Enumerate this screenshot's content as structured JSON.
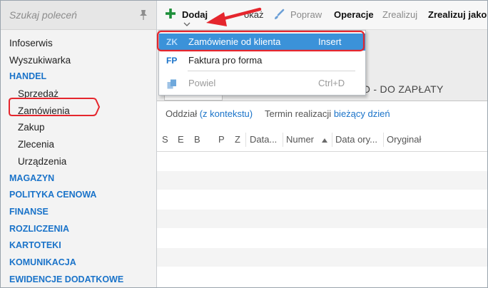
{
  "sidebar": {
    "search_placeholder": "Szukaj poleceń",
    "items": [
      {
        "label": "Infoserwis"
      },
      {
        "label": "Wyszukiwarka"
      },
      {
        "label": "HANDEL"
      },
      {
        "label": "Sprzedaż"
      },
      {
        "label": "Zamówienia"
      },
      {
        "label": "Zakup"
      },
      {
        "label": "Zlecenia"
      },
      {
        "label": "Urządzenia"
      },
      {
        "label": "MAGAZYN"
      },
      {
        "label": "POLITYKA CENOWA"
      },
      {
        "label": "FINANSE"
      },
      {
        "label": "ROZLICZENIA"
      },
      {
        "label": "KARTOTEKI"
      },
      {
        "label": "KOMUNIKACJA"
      },
      {
        "label": "EWIDENCJE DODATKOWE"
      }
    ]
  },
  "toolbar": {
    "add": "Dodaj",
    "show_partial": "okaż",
    "edit": "Popraw",
    "operations": "Operacje",
    "execute": "Zrealizuj",
    "execute_as": "Zrealizuj jako"
  },
  "content": {
    "tab_title": "O - DO ZAPŁATY",
    "filter_branch_label": "Oddział",
    "filter_branch_value": "(z kontekstu)",
    "filter_due_label": "Termin realizacji",
    "filter_due_value": "bieżący dzień"
  },
  "grid": {
    "columns": [
      "S",
      "E",
      "B",
      "P",
      "Z",
      "Data...",
      "Numer",
      "Data ory...",
      "Oryginał"
    ]
  },
  "menu": {
    "items": [
      {
        "abbr": "ZK",
        "label": "Zamówienie od klienta",
        "shortcut": "Insert"
      },
      {
        "abbr": "FP",
        "label": "Faktura pro forma",
        "shortcut": ""
      },
      {
        "abbr": "",
        "label": "Powiel",
        "shortcut": "Ctrl+D"
      }
    ]
  },
  "colors": {
    "accent": "#1a73c9",
    "highlight": "#3b92d9",
    "annotation": "#e5262d"
  }
}
